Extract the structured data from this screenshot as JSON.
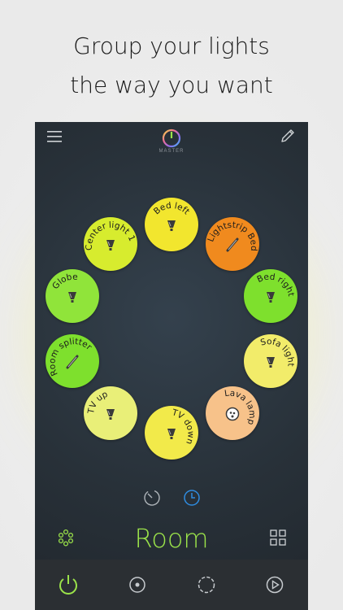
{
  "headline": {
    "line1": "Group your lights",
    "line2": "the way you want"
  },
  "header": {
    "master_label": "MASTER"
  },
  "lights": [
    {
      "label": "Bed left",
      "color": "#f2e62e",
      "icon": "bulb-icon"
    },
    {
      "label": "Lightstrip Bed",
      "color": "#f08a1e",
      "icon": "lightstrip-icon"
    },
    {
      "label": "Bed right",
      "color": "#7ee02d",
      "icon": "bulb-icon"
    },
    {
      "label": "Sofa light",
      "color": "#f2ec6a",
      "icon": "bulb-icon"
    },
    {
      "label": "Lava lamp",
      "color": "#f7c28a",
      "icon": "lava-lamp-icon"
    },
    {
      "label": "TV down",
      "color": "#f2ea4a",
      "icon": "bulb-icon"
    },
    {
      "label": "TV up",
      "color": "#e9ef78",
      "icon": "bulb-icon"
    },
    {
      "label": "Room splitter",
      "color": "#7ee02d",
      "icon": "lightstrip-icon"
    },
    {
      "label": "Globe",
      "color": "#90e43a",
      "icon": "bulb-icon"
    },
    {
      "label": "Center light 1",
      "color": "#d7ec2e",
      "icon": "bulb-icon"
    }
  ],
  "mode_icons": [
    "timer-icon",
    "clock-icon"
  ],
  "room": {
    "title": "Room"
  },
  "tabs": [
    "power-icon",
    "record-icon",
    "scene-icon",
    "play-icon"
  ],
  "colors": {
    "accent": "#9be34a",
    "selected_blue": "#2f8ce0"
  }
}
